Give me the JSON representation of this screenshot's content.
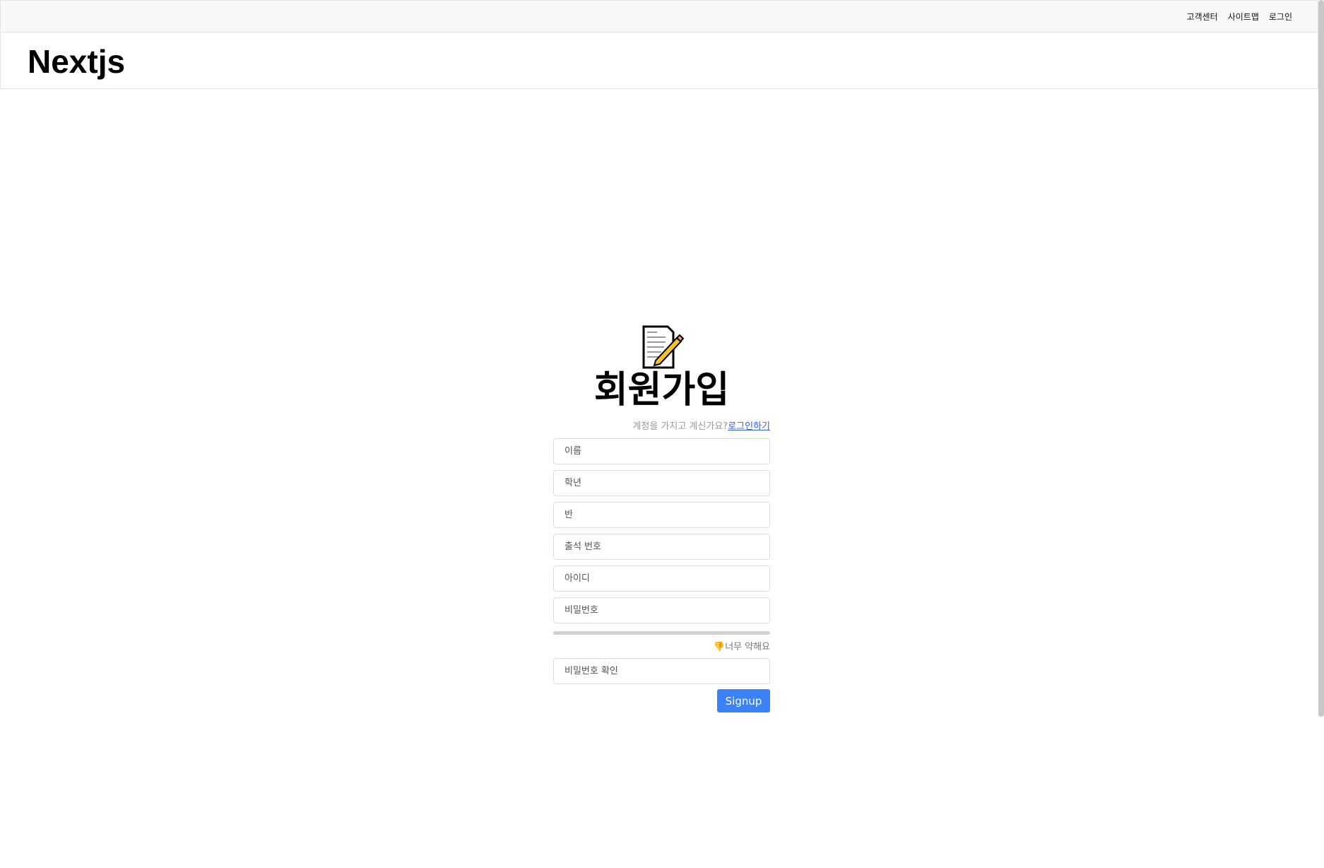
{
  "topbar": {
    "items": [
      "고객센터",
      "사이트맵",
      "로그인"
    ]
  },
  "header": {
    "logo": "Nextjs"
  },
  "form": {
    "icon": "memo-pencil-icon",
    "title": "회원가입",
    "subtitle": "계정을 가지고 계신가요?",
    "login_link": "로그인하기",
    "fields": {
      "name": "이름",
      "grade": "학년",
      "class": "반",
      "number": "출석 번호",
      "id": "아이디",
      "password": "비밀번호",
      "password_confirm": "비밀번호 확인"
    },
    "strength": {
      "icon": "thumbs-down-icon",
      "label": "너무 약해요",
      "value": 0
    },
    "submit": "Signup"
  },
  "colors": {
    "accent": "#3b82f6",
    "link": "#2f5fe8"
  }
}
